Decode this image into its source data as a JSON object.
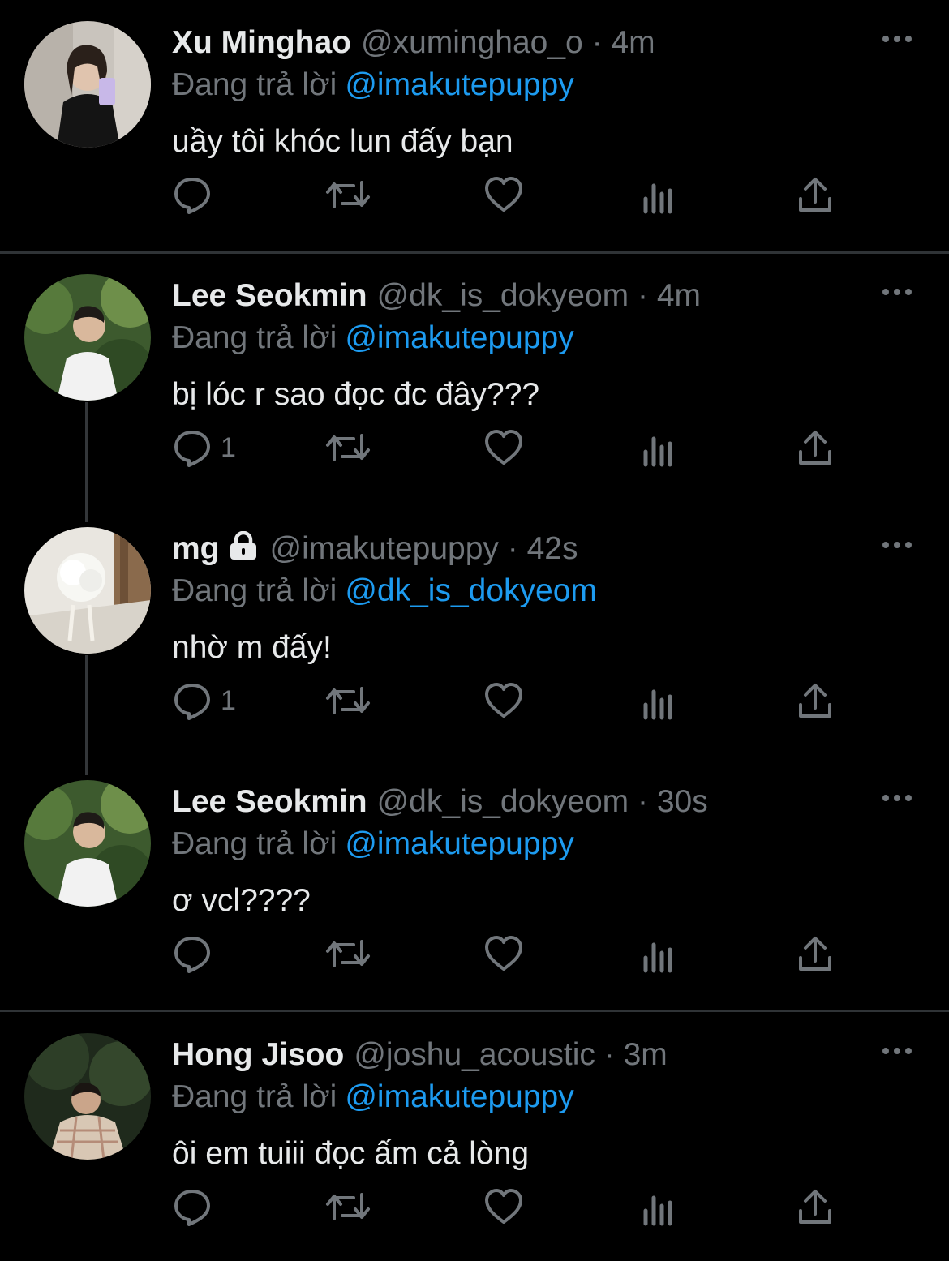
{
  "reply_prefix": "Đang trả lời",
  "tweets": [
    {
      "name": "Xu Minghao",
      "handle": "@xuminghao_o",
      "time": "4m",
      "reply_to": "@imakutepuppy",
      "text": "uầy tôi khóc lun đấy bạn",
      "reply_count": "",
      "avatar": "photo of person taking mirror selfie"
    },
    {
      "name": "Lee Seokmin",
      "handle": "@dk_is_dokyeom",
      "time": "4m",
      "reply_to": "@imakutepuppy",
      "text": "bị lóc r sao đọc đc đây???",
      "reply_count": "1",
      "avatar": "photo of man in white shirt in garden"
    },
    {
      "name": "mg",
      "handle": "@imakutepuppy",
      "time": "42s",
      "reply_to": "@dk_is_dokyeom",
      "text": "nhờ m đấy!",
      "reply_count": "1",
      "protected": true,
      "avatar": "photo of white rose"
    },
    {
      "name": "Lee Seokmin",
      "handle": "@dk_is_dokyeom",
      "time": "30s",
      "reply_to": "@imakutepuppy",
      "text": "ơ vcl????",
      "reply_count": "",
      "avatar": "photo of man in white shirt in garden"
    },
    {
      "name": "Hong Jisoo",
      "handle": "@joshu_acoustic",
      "time": "3m",
      "reply_to": "@imakutepuppy",
      "text": "ôi em tuiii đọc ấm cả lòng",
      "reply_count": "",
      "avatar": "photo of man in checkered shirt outdoors"
    }
  ],
  "icons": {
    "reply": "speech-bubble-icon",
    "retweet": "retweet-icon",
    "like": "heart-icon",
    "views": "analytics-icon",
    "share": "share-icon",
    "more": "more-dots-icon",
    "protected": "lock-icon"
  },
  "colors": {
    "background": "#000000",
    "text": "#e7e9ea",
    "secondary": "#71767b",
    "link": "#1d9bf0",
    "divider": "#2f3336"
  }
}
